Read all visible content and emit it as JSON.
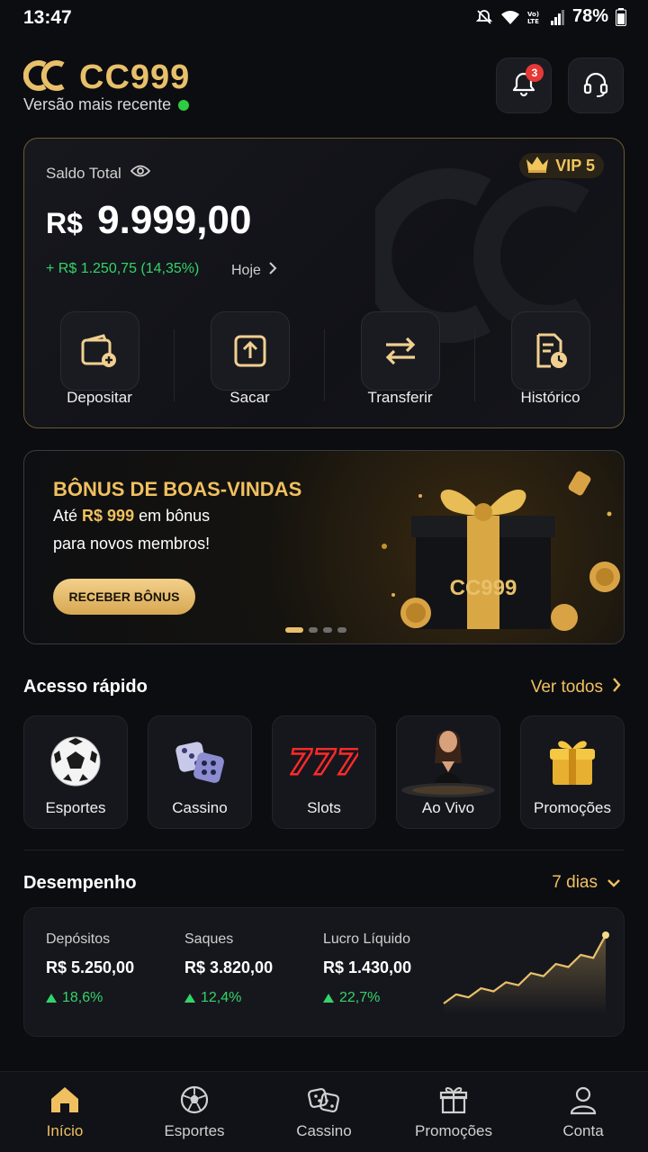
{
  "status_bar": {
    "time": "13:47",
    "battery": "78%"
  },
  "header": {
    "logo_text": "CC999",
    "subtitle": "Versão mais recente",
    "notification_count": "3",
    "icons": {
      "notifications": "bell-icon",
      "support": "headset-icon"
    }
  },
  "balance": {
    "label": "Saldo Total",
    "vip": "VIP 5",
    "currency": "R$",
    "amount": "9.999,00",
    "change": "+ R$ 1.250,75 (14,35%)",
    "period": "Hoje",
    "actions": [
      {
        "label": "Depositar",
        "icon": "wallet-plus-icon"
      },
      {
        "label": "Sacar",
        "icon": "upload-icon"
      },
      {
        "label": "Transferir",
        "icon": "transfer-icon"
      },
      {
        "label": "Histórico",
        "icon": "history-doc-icon"
      }
    ]
  },
  "banner": {
    "title": "BÔNUS DE BOAS-VINDAS",
    "line1_pre": "Até ",
    "line1_highlight": "R$ 999",
    "line1_post": " em bônus",
    "line2": "para novos membros!",
    "button": "RECEBER BÔNUS",
    "gift_text": "CC999",
    "slides": 4,
    "active_slide": 1
  },
  "quick_access": {
    "title": "Acesso rápido",
    "link": "Ver todos",
    "items": [
      {
        "label": "Esportes",
        "icon": "soccer-ball-icon"
      },
      {
        "label": "Cassino",
        "icon": "dice-icon"
      },
      {
        "label": "Slots",
        "icon": "slots-777-icon"
      },
      {
        "label": "Ao Vivo",
        "icon": "live-dealer-icon"
      },
      {
        "label": "Promoções",
        "icon": "gift-box-icon"
      }
    ]
  },
  "performance": {
    "title": "Desempenho",
    "period": "7 dias",
    "metrics": [
      {
        "label": "Depósitos",
        "value": "R$ 5.250,00",
        "change": "18,6%"
      },
      {
        "label": "Saques",
        "value": "R$ 3.820,00",
        "change": "12,4%"
      },
      {
        "label": "Lucro Líquido",
        "value": "R$ 1.430,00",
        "change": "22,7%"
      }
    ],
    "sparkline": [
      10,
      22,
      18,
      30,
      26,
      38,
      34,
      50,
      46,
      62,
      58,
      74,
      70,
      100
    ]
  },
  "bottom_nav": [
    {
      "label": "Início",
      "icon": "home-icon",
      "active": true
    },
    {
      "label": "Esportes",
      "icon": "soccer-ball-icon",
      "active": false
    },
    {
      "label": "Cassino",
      "icon": "dice-icon",
      "active": false
    },
    {
      "label": "Promoções",
      "icon": "gift-icon",
      "active": false
    },
    {
      "label": "Conta",
      "icon": "user-icon",
      "active": false
    }
  ],
  "colors": {
    "accent": "#f0c060",
    "positive": "#33d46a",
    "badge": "#e53935",
    "background": "#0c0d11"
  }
}
